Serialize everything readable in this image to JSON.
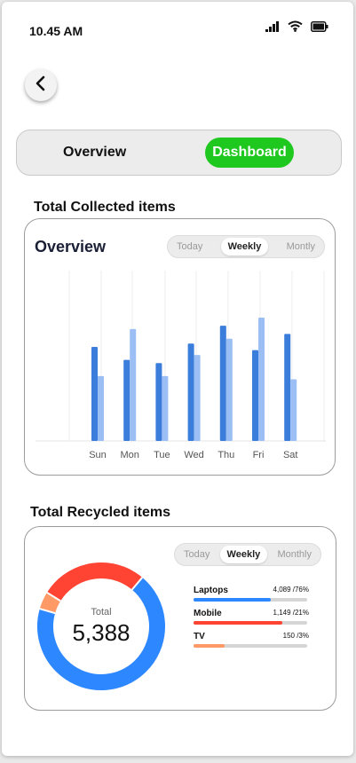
{
  "status": {
    "time": "10.45 AM",
    "icons": [
      "signal-icon",
      "wifi-icon",
      "battery-icon"
    ]
  },
  "nav": {
    "back_icon": "chevron-left-icon"
  },
  "segment": {
    "overview_label": "Overview",
    "dashboard_label": "Dashboard",
    "active": "Dashboard",
    "active_color": "#1ec81e"
  },
  "collected": {
    "section_title": "Total Collected items",
    "card_title": "Overview",
    "tabs": [
      {
        "label": "Today"
      },
      {
        "label": "Weekly"
      },
      {
        "label": "Montly"
      }
    ],
    "active_tab": "Weekly"
  },
  "recycled": {
    "section_title": "Total Recycled items",
    "tabs": [
      {
        "label": "Today"
      },
      {
        "label": "Weekly"
      },
      {
        "label": "Monthly"
      }
    ],
    "active_tab": "Weekly",
    "total_label": "Total",
    "total_value": "5,388",
    "items": [
      {
        "name": "Laptops",
        "value": "4,089 /76%",
        "percent": 76,
        "color": "#2d87ff"
      },
      {
        "name": "Mobile",
        "value": "1,149 /21%",
        "percent": 21,
        "color": "#ff4433"
      },
      {
        "name": "TV",
        "value": "150 /3%",
        "percent": 3,
        "color": "#ff9966"
      }
    ]
  },
  "chart_data": {
    "type": "bar",
    "categories": [
      "Sun",
      "Mon",
      "Tue",
      "Wed",
      "Thu",
      "Fri",
      "Sat"
    ],
    "series": [
      {
        "values": [
          58,
          50,
          48,
          60,
          71,
          56,
          66
        ],
        "color": "#3b7ddb"
      },
      {
        "values": [
          40,
          69,
          40,
          53,
          63,
          76,
          38
        ],
        "color": "#9bbff5"
      }
    ],
    "ylim": [
      0,
      105
    ],
    "grid": "vertical"
  }
}
